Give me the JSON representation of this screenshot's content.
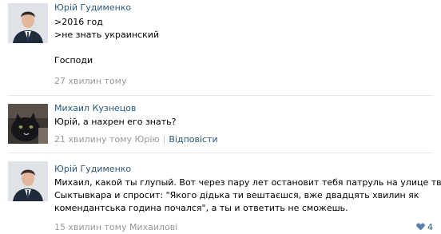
{
  "comments": [
    {
      "author": "Юрій Гудименко",
      "lines": [
        ">2016 год",
        ">не знать украинский",
        "",
        "Господи"
      ],
      "time": "27 хвилин тому"
    },
    {
      "author": "Михаил Кузнецов",
      "lines": [
        "Юрій, а нахрен его знать?"
      ],
      "time": "21 хвилину тому Юрію",
      "separator": "|",
      "reply_link": "Відповісти"
    },
    {
      "author": "Юрій Гудименко",
      "lines": [
        "Михаил, какой ты глупый. Вот через пару лет остановит тебя патруль на улице твоего",
        "Сыктывкара и спросит: \"Якого дідька ти вештаєшся, вже двадцять хвилин як",
        "комендантська година почался\", а ты и ответить не сможешь."
      ],
      "time": "15 хвилин тому Михаилові",
      "likes": "4"
    }
  ],
  "colors": {
    "link": "#2b587a",
    "meta": "#999999",
    "divider": "#e7e8ec"
  },
  "icons": {
    "like": "heart-icon"
  }
}
